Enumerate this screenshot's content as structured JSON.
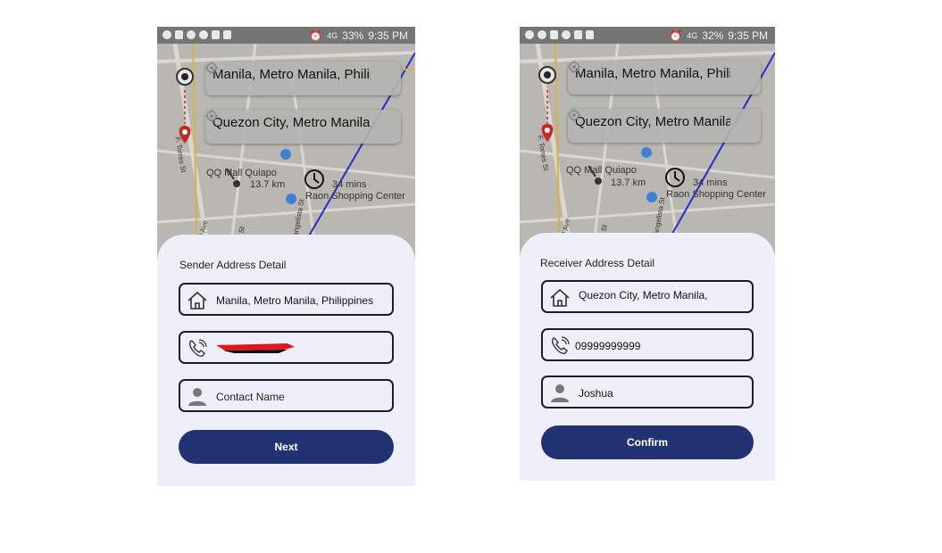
{
  "screens": [
    {
      "status": {
        "battery": "33%",
        "time": "9:35 PM",
        "net": "4G"
      },
      "map": {
        "origin": "Manila, Metro Manila, Philippines",
        "destination": "Quezon City, Metro Manila, Philippines",
        "distance": "13.7 km",
        "duration": "34 mins",
        "poi1": "QQ Mall Quiapo",
        "poi2": "Raon Shopping Center",
        "street1": "F. Torres St",
        "street2": "Rizal Ave",
        "street3": "Sales St",
        "street4": "Evangelista St"
      },
      "sheet": {
        "title": "Sender Address Detail",
        "address": "Manila, Metro Manila, Philippines",
        "phone": "",
        "contact_placeholder": "Contact Name",
        "button": "Next"
      }
    },
    {
      "status": {
        "battery": "32%",
        "time": "9:35 PM",
        "net": "4G"
      },
      "map": {
        "origin": "Manila, Metro Manila, Philippines",
        "destination": "Quezon City, Metro Manila, Philippines",
        "distance": "13.7 km",
        "duration": "34 mins",
        "poi1": "QQ Mall Quiapo",
        "poi2": "Raon Shopping Center",
        "street1": "F. Torres St",
        "street2": "Rizal Ave",
        "street3": "Sales St",
        "street4": "Evangelista St"
      },
      "sheet": {
        "title": "Receiver Address Detail",
        "address": "Quezon City, Metro Manila, Philippines",
        "phone": "09999999999",
        "contact_name": "Joshua",
        "button": "Confirm"
      }
    }
  ],
  "colors": {
    "accent": "#223373",
    "sheet": "#efeff9",
    "pin": "#c62828",
    "map": "#b9b7b1"
  },
  "icons": [
    "home-icon",
    "phone-icon",
    "person-icon",
    "target-icon",
    "origin-pin-icon",
    "destination-pin-icon",
    "clock-icon",
    "scooter-icon"
  ]
}
